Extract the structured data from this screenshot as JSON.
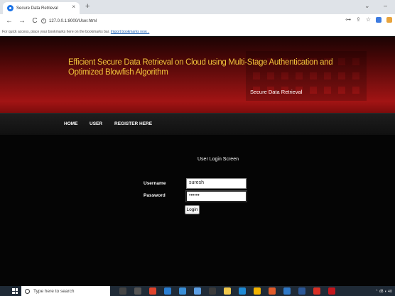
{
  "browser": {
    "tab_title": "Secure Data Retrieval",
    "tab_close": "×",
    "new_tab": "+",
    "url": "127.0.0.1:8000/User.html",
    "back_icon": "←",
    "forward_icon": "→",
    "reload_icon": "C",
    "bookmarks_prompt": "For quick access, place your bookmarks here on the bookmarks bar.",
    "bookmarks_link": "Import bookmarks now...",
    "minimize_icon": "–",
    "chevron_icon": "⌄"
  },
  "site": {
    "title": "Efficient Secure Data Retrieval on Cloud using Multi-Stage Authentication and Optimized Blowfish Algorithm",
    "subtitle": "Secure Data Retrieval",
    "nav": [
      "HOME",
      "USER",
      "REGISTER HERE"
    ]
  },
  "login": {
    "heading": "User Login Screen",
    "username_label": "Username",
    "username_value": "suresh",
    "password_label": "Password",
    "password_value": "••••••",
    "submit_label": "Login"
  },
  "taskbar": {
    "search_placeholder": "Type here to search",
    "tray_text": "⌃ ㏈ ◖ 40"
  },
  "colors": {
    "banner_title": "#f0c23a",
    "banner_red": "#a21414",
    "page_bg": "#0c0c0c",
    "taskbar_bg": "#1f2a36"
  }
}
